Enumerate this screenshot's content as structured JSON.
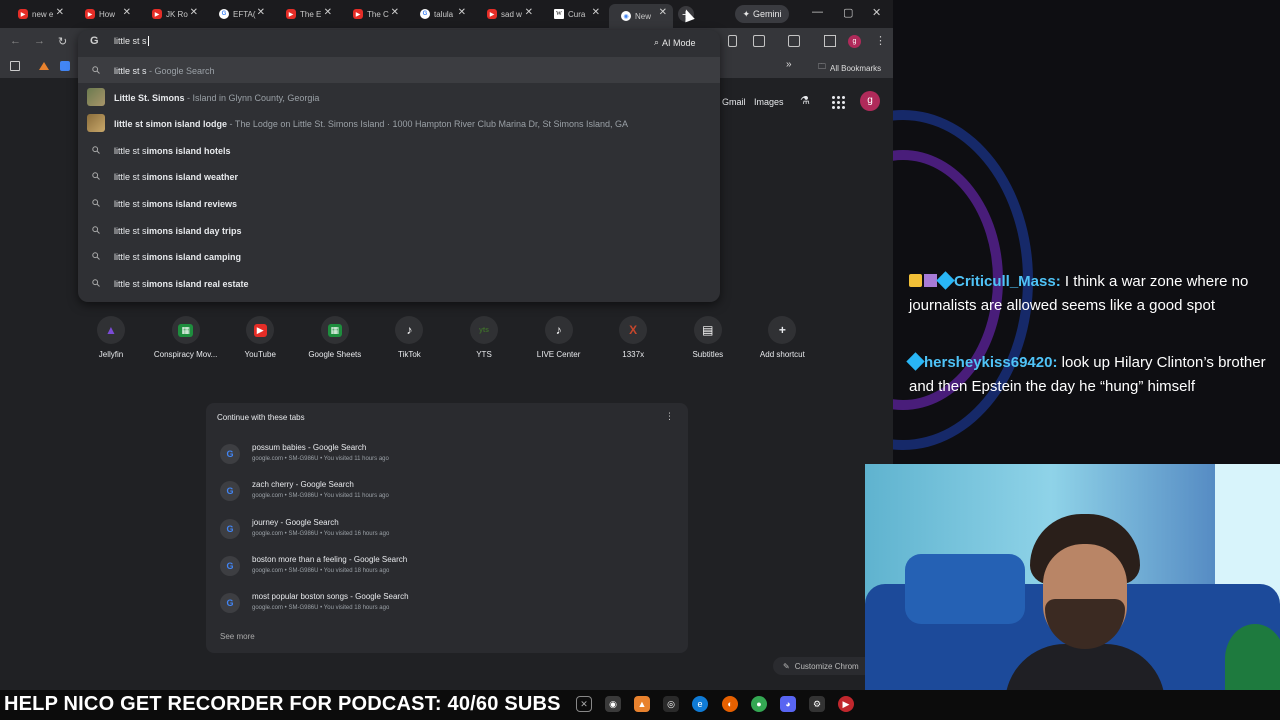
{
  "tabs": [
    {
      "label": "new e",
      "favicon": "youtube-icon"
    },
    {
      "label": "How",
      "favicon": "youtube-icon"
    },
    {
      "label": "JK Ro",
      "favicon": "youtube-icon"
    },
    {
      "label": "EFTA(",
      "favicon": "google-icon"
    },
    {
      "label": "The E",
      "favicon": "youtube-icon"
    },
    {
      "label": "The C",
      "favicon": "youtube-icon"
    },
    {
      "label": "talula",
      "favicon": "google-icon"
    },
    {
      "label": "sad w",
      "favicon": "youtube-icon"
    },
    {
      "label": "Cura",
      "favicon": "wikipedia-icon"
    },
    {
      "label": "New",
      "favicon": "chrome-icon",
      "active": true
    }
  ],
  "gemini_label": "Gemini",
  "omnibox": {
    "text": "little st s",
    "ai_mode_label": "AI Mode"
  },
  "suggestions": [
    {
      "type": "search",
      "bold": "",
      "normal": "little st s",
      "sub": " - Google Search"
    },
    {
      "type": "place",
      "bold": "Little St. Simons",
      "normal": "",
      "sub": " - Island in Glynn County, Georgia"
    },
    {
      "type": "place",
      "bold": "little st simon island lodge",
      "normal": "",
      "sub": " - The Lodge on Little St. Simons Island · 1000 Hampton River Club Marina Dr, St Simons Island, GA"
    },
    {
      "type": "search",
      "normal": "little st s",
      "bold": "imons island hotels"
    },
    {
      "type": "search",
      "normal": "little st s",
      "bold": "imons island weather"
    },
    {
      "type": "search",
      "normal": "little st s",
      "bold": "imons island reviews"
    },
    {
      "type": "search",
      "normal": "little st s",
      "bold": "imons island day trips"
    },
    {
      "type": "search",
      "normal": "little st s",
      "bold": "imons island camping"
    },
    {
      "type": "search",
      "normal": "little st s",
      "bold": "imons island real estate"
    }
  ],
  "bookmarks": {
    "all_bookmarks_label": "All Bookmarks"
  },
  "ntp": {
    "gmail_label": "Gmail",
    "images_label": "Images",
    "account_initial": "g",
    "shortcuts": [
      {
        "label": "Jellyfin",
        "icon": "jellyfin-icon",
        "color": "#7b4bd6"
      },
      {
        "label": "Conspiracy Mov...",
        "icon": "sheets-icon",
        "color": "#1e8e3e"
      },
      {
        "label": "YouTube",
        "icon": "youtube-icon",
        "color": "#e52d27"
      },
      {
        "label": "Google Sheets",
        "icon": "sheets-icon",
        "color": "#1e8e3e"
      },
      {
        "label": "TikTok",
        "icon": "tiktok-icon",
        "color": "#111111"
      },
      {
        "label": "YTS",
        "icon": "yts-icon",
        "color": "#3d6b2b"
      },
      {
        "label": "LIVE Center",
        "icon": "tiktok-icon",
        "color": "#111111"
      },
      {
        "label": "1337x",
        "icon": "1337x-icon",
        "color": "#c6462c"
      },
      {
        "label": "Subtitles",
        "icon": "subtitles-icon",
        "color": "#444444"
      },
      {
        "label": "Add shortcut",
        "icon": "plus-icon",
        "color": "#303134"
      }
    ],
    "continue_title": "Continue with these tabs",
    "continue_tabs": [
      {
        "title": "possum babies - Google Search",
        "meta": "google.com • SM-G986U • You visited 11 hours ago"
      },
      {
        "title": "zach cherry - Google Search",
        "meta": "google.com • SM-G986U • You visited 11 hours ago"
      },
      {
        "title": "journey - Google Search",
        "meta": "google.com • SM-G986U • You visited 16 hours ago"
      },
      {
        "title": "boston more than a feeling - Google Search",
        "meta": "google.com • SM-G986U • You visited 18 hours ago"
      },
      {
        "title": "most popular boston songs - Google Search",
        "meta": "google.com • SM-G986U • You visited 18 hours ago"
      }
    ],
    "see_more": "See more",
    "customize_label": "Customize Chrom"
  },
  "chat": [
    {
      "user": "Criticull_Mass:",
      "message": " I think a war zone where no journalists are allowed seems like a good spot"
    },
    {
      "user": "hersheykiss69420:",
      "message": " look up Hilary Clinton’s brother and then Epstein the day he “hung” himself"
    }
  ],
  "marquee": "HELP NICO GET RECORDER FOR PODCAST: 40/60 SUBS"
}
